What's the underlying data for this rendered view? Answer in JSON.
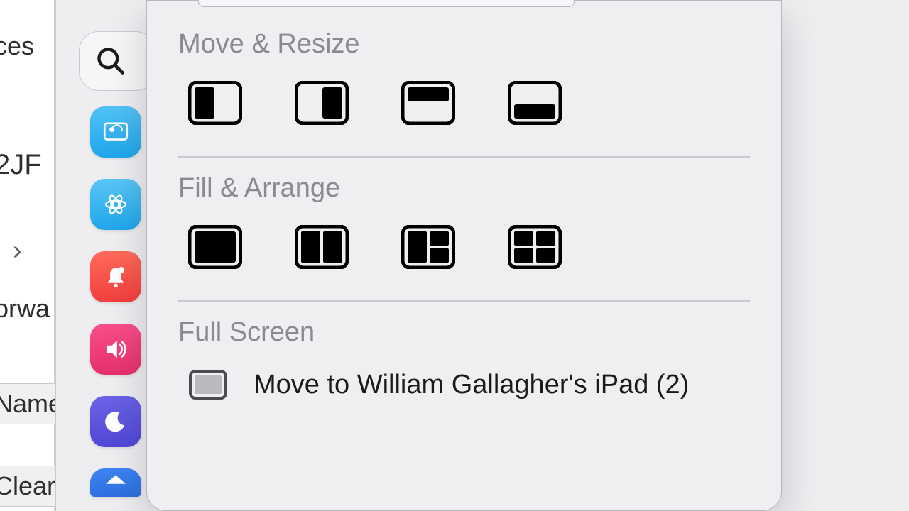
{
  "background": {
    "frag1": "ces",
    "frag2": "2JF",
    "frag3": "orwa",
    "frag4": "Name",
    "frag5": "Clear"
  },
  "sections": {
    "move_resize": "Move & Resize",
    "fill_arrange": "Fill & Arrange",
    "full_screen": "Full Screen"
  },
  "fullscreen_item": {
    "label": "Move to William Gallagher's iPad (2)"
  }
}
